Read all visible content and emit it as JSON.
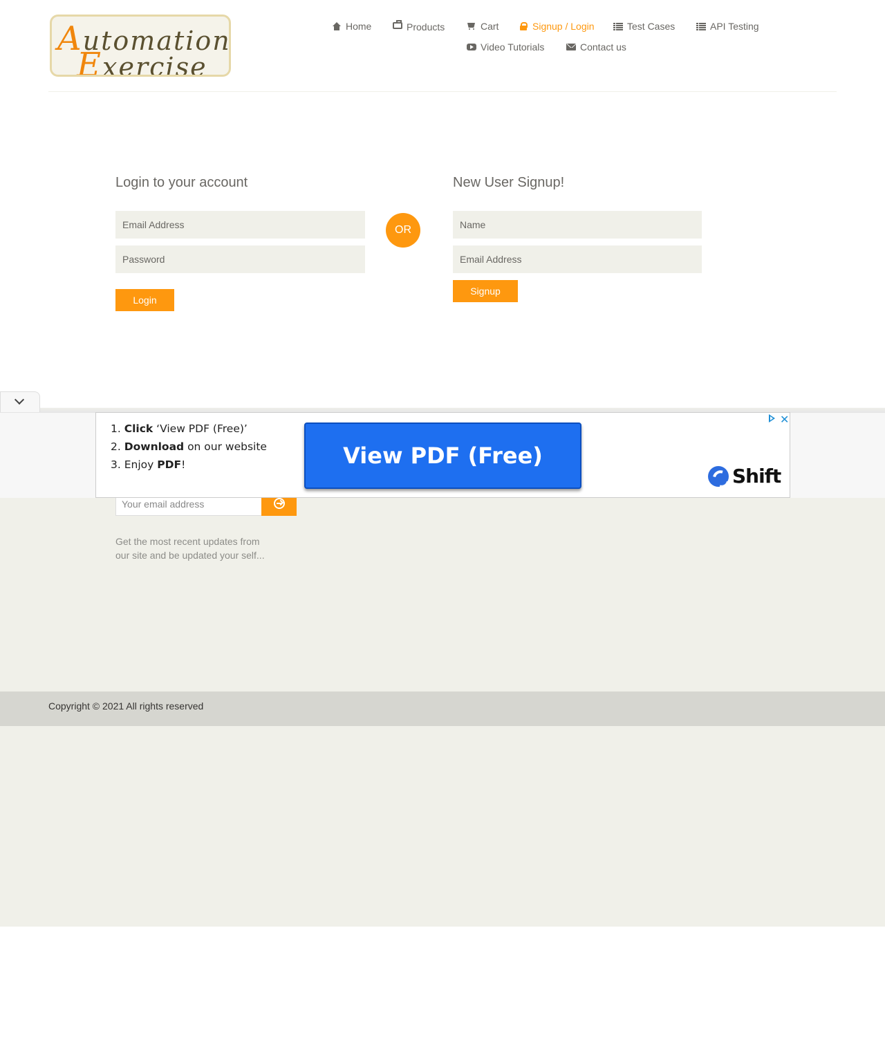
{
  "header": {
    "logo_line1_initial": "A",
    "logo_line1_rest": "utomation",
    "logo_line2_initial": "E",
    "logo_line2_rest": "xercise",
    "nav": [
      {
        "label": "Home",
        "icon": "home-icon"
      },
      {
        "label": "Products",
        "icon": "briefcase-icon"
      },
      {
        "label": "Cart",
        "icon": "shopping-cart-icon"
      },
      {
        "label": "Signup / Login",
        "icon": "lock-icon",
        "active": true
      },
      {
        "label": "Test Cases",
        "icon": "list-icon"
      },
      {
        "label": "API Testing",
        "icon": "list-icon"
      },
      {
        "label": "Video Tutorials",
        "icon": "youtube-play-icon"
      },
      {
        "label": "Contact us",
        "icon": "envelope-icon"
      }
    ]
  },
  "login": {
    "title": "Login to your account",
    "email_placeholder": "Email Address",
    "password_placeholder": "Password",
    "button": "Login"
  },
  "or_label": "OR",
  "signup": {
    "title": "New User Signup!",
    "name_placeholder": "Name",
    "email_placeholder": "Email Address",
    "button": "Signup"
  },
  "footer": {
    "subscribe_placeholder": "Your email address",
    "subscribe_desc": "Get the most recent updates from our site and be updated your self...",
    "copyright": "Copyright © 2021 All rights reserved"
  },
  "ad": {
    "step1_num": "1.",
    "step1_bold": "Click",
    "step1_rest": "‘View PDF (Free)’",
    "step2_num": "2.",
    "step2_bold": "Download",
    "step2_rest": "on our website",
    "step3_num": "3.",
    "step3_pre": "Enjoy",
    "step3_bold": "PDF",
    "step3_post": "!",
    "cta": "View PDF (Free)",
    "brand": "Shift",
    "close": "✕"
  },
  "colors": {
    "accent": "#fe980f",
    "text": "#696763",
    "input_bg": "#f0f0e9",
    "footer_bg": "#f0f0e9",
    "footer_bottom_bg": "#d6d6d0",
    "ad_cta": "#1e6ff0"
  }
}
